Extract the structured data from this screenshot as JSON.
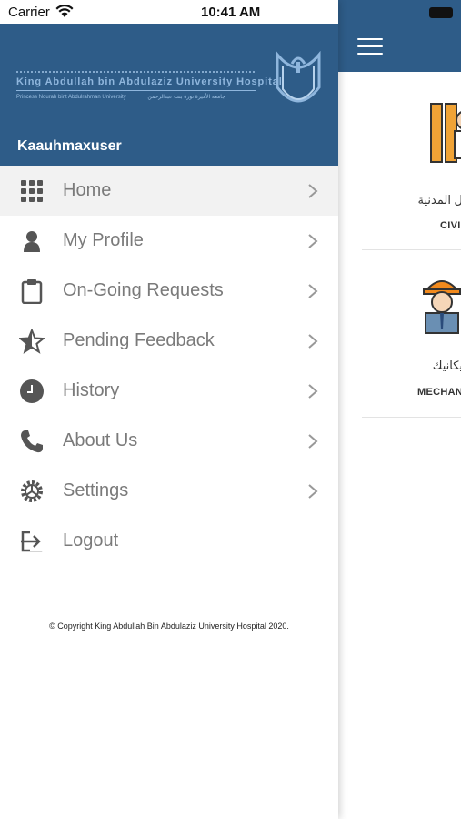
{
  "status_bar": {
    "carrier": "Carrier",
    "time": "10:41 AM"
  },
  "drawer": {
    "logo": {
      "english_name": "King Abdullah bin Abdulaziz University Hospital",
      "sub_left": "Princess Nourah bint Abdulrahman University",
      "sub_right": "جامعة الأميرة نورة بنت عبدالرحمن"
    },
    "username": "Kaauhmaxuser",
    "menu": [
      {
        "label": "Home",
        "icon": "grid-icon",
        "has_chevron": true,
        "active": true
      },
      {
        "label": "My Profile",
        "icon": "person-icon",
        "has_chevron": true
      },
      {
        "label": "On-Going Requests",
        "icon": "clipboard-icon",
        "has_chevron": true
      },
      {
        "label": "Pending Feedback",
        "icon": "star-icon",
        "has_chevron": true
      },
      {
        "label": "History",
        "icon": "clock-icon",
        "has_chevron": true
      },
      {
        "label": "About Us",
        "icon": "phone-icon",
        "has_chevron": true
      },
      {
        "label": "Settings",
        "icon": "gear-icon",
        "has_chevron": true
      },
      {
        "label": "Logout",
        "icon": "logout-icon",
        "has_chevron": false
      }
    ],
    "copyright": "© Copyright King Abdullah Bin Abdulaziz University Hospital 2020."
  },
  "background": {
    "cards": [
      {
        "arabic": "ل المدنية",
        "english": "CIVI"
      },
      {
        "arabic": "يكانيك",
        "english": "MECHAN"
      }
    ]
  },
  "colors": {
    "header_blue": "#2e5c88",
    "menu_text": "#7a7a7a",
    "active_row": "#f2f2f2"
  }
}
